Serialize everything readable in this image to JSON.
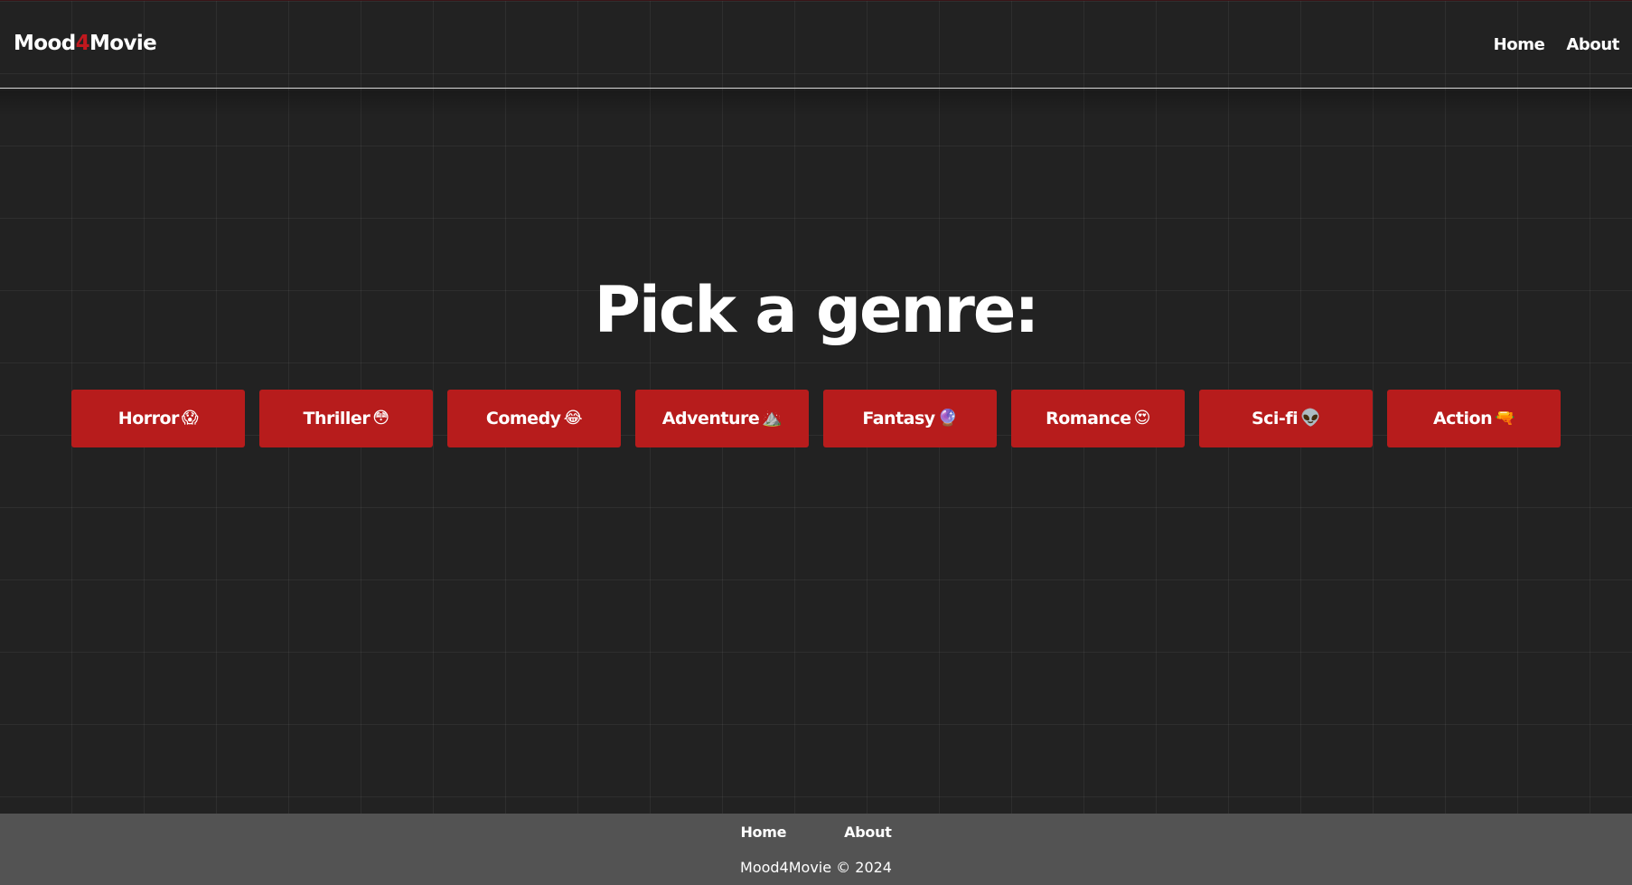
{
  "header": {
    "logo_part1": "Mood",
    "logo_accent": "4",
    "logo_part2": "Movie",
    "nav": [
      {
        "label": "Home"
      },
      {
        "label": "About"
      }
    ]
  },
  "main": {
    "title": "Pick a genre:",
    "genres": [
      {
        "label": "Horror",
        "emoji": "😱"
      },
      {
        "label": "Thriller",
        "emoji": "😳"
      },
      {
        "label": "Comedy",
        "emoji": "😂"
      },
      {
        "label": "Adventure",
        "emoji": "⛰️"
      },
      {
        "label": "Fantasy",
        "emoji": "🔮"
      },
      {
        "label": "Romance",
        "emoji": "😍"
      },
      {
        "label": "Sci-fi",
        "emoji": "👽"
      },
      {
        "label": "Action",
        "emoji": "🔫"
      }
    ]
  },
  "footer": {
    "nav": [
      {
        "label": "Home"
      },
      {
        "label": "About"
      }
    ],
    "copyright": "Mood4Movie © 2024"
  },
  "colors": {
    "background": "#222222",
    "accent": "#b71c1c",
    "logo_accent": "#c0181e",
    "footer": "#535353",
    "text": "#ffffff"
  }
}
